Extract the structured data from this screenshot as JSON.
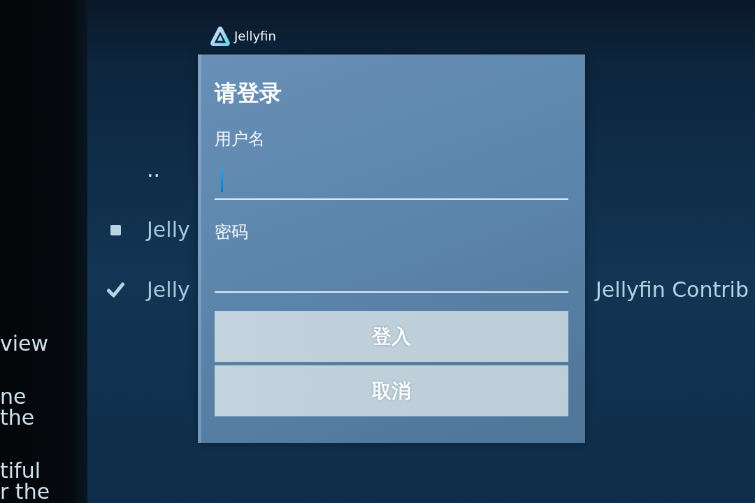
{
  "left_panel": {
    "text_blocks": [
      {
        "lines": [
          "view"
        ]
      },
      {
        "lines": [
          "ne",
          "the"
        ]
      },
      {
        "lines": [
          "tiful",
          "r the"
        ]
      }
    ]
  },
  "header": {
    "logo_text": "Jellyfin"
  },
  "list": [
    {
      "kind": "parent",
      "label": ".."
    },
    {
      "kind": "entry",
      "label": "Jelly",
      "checked": false
    },
    {
      "kind": "entry",
      "label": "Jelly",
      "checked": true,
      "detail": "Jellyfin Contrib"
    }
  ],
  "login_dialog": {
    "title": "请登录",
    "fields": [
      {
        "label": "用户名",
        "focused": true
      },
      {
        "label": "密码",
        "focused": false
      }
    ],
    "buttons": [
      {
        "label": "登入"
      },
      {
        "label": "取消"
      }
    ]
  }
}
